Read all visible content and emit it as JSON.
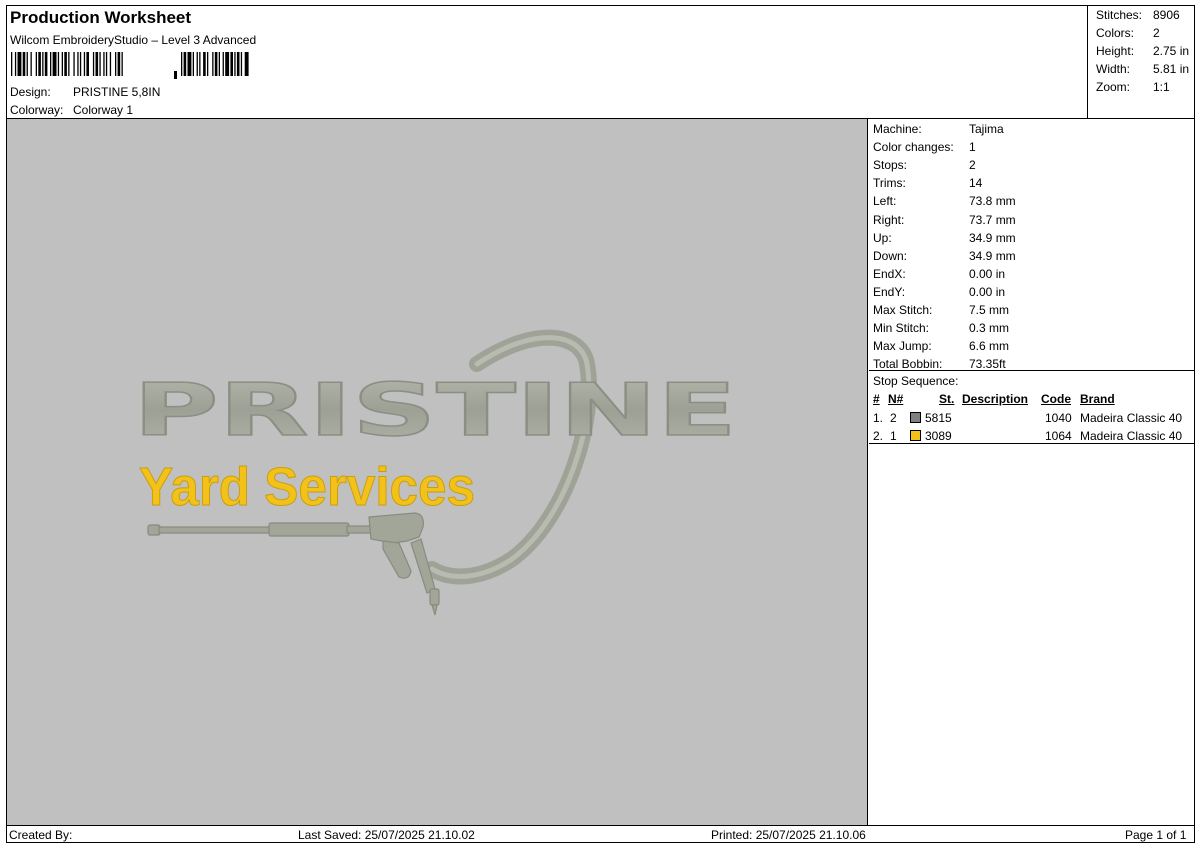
{
  "header": {
    "title": "Production Worksheet",
    "subtitle": "Wilcom EmbroideryStudio – Level 3 Advanced",
    "design_label": "Design:",
    "design_value": "PRISTINE 5,8IN",
    "colorway_label": "Colorway:",
    "colorway_value": "Colorway 1"
  },
  "stats": [
    {
      "label": "Stitches:",
      "value": "8906"
    },
    {
      "label": "Colors:",
      "value": "2"
    },
    {
      "label": "Height:",
      "value": "2.75 in"
    },
    {
      "label": "Width:",
      "value": "5.81 in"
    },
    {
      "label": "Zoom:",
      "value": "1:1"
    }
  ],
  "design": {
    "logo_text": "PRISTINE",
    "tagline": "Yard Services",
    "thread_gray": "#a7ab9e",
    "thread_yellow": "#f2c21b",
    "background": "#c0c0c0"
  },
  "info": [
    {
      "label": "Machine:",
      "value": "Tajima"
    },
    {
      "label": "Color changes:",
      "value": "1"
    },
    {
      "label": "Stops:",
      "value": "2"
    },
    {
      "label": "Trims:",
      "value": "14"
    },
    {
      "label": "Left:",
      "value": "73.8 mm"
    },
    {
      "label": "Right:",
      "value": "73.7 mm"
    },
    {
      "label": "Up:",
      "value": "34.9 mm"
    },
    {
      "label": "Down:",
      "value": "34.9 mm"
    },
    {
      "label": "EndX:",
      "value": "0.00 in"
    },
    {
      "label": "EndY:",
      "value": "0.00 in"
    },
    {
      "label": "Max Stitch:",
      "value": "7.5 mm"
    },
    {
      "label": "Min Stitch:",
      "value": "0.3 mm"
    },
    {
      "label": "Max Jump:",
      "value": "6.6 mm"
    },
    {
      "label": "Total Bobbin:",
      "value": "73.35ft"
    }
  ],
  "stop_sequence": {
    "title": "Stop Sequence:",
    "headers": {
      "num": "#",
      "n": "N#",
      "st": "St.",
      "description": "Description",
      "code": "Code",
      "brand": "Brand"
    },
    "rows": [
      {
        "num": "1.",
        "n": "2",
        "color": "#808080",
        "st": "5815",
        "code": "1040",
        "brand": "Madeira Classic 40"
      },
      {
        "num": "2.",
        "n": "1",
        "color": "#f2c21b",
        "st": "3089",
        "code": "1064",
        "brand": "Madeira Classic 40"
      }
    ]
  },
  "footer": {
    "created_by": "Created By:",
    "last_saved": "Last Saved: 25/07/2025 21.10.02",
    "printed": "Printed: 25/07/2025 21.10.06",
    "page": "Page 1 of 1"
  }
}
